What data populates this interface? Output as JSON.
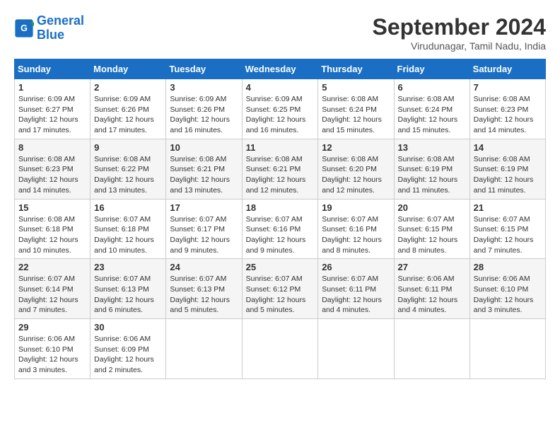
{
  "logo": {
    "line1": "General",
    "line2": "Blue"
  },
  "title": {
    "month_year": "September 2024",
    "location": "Virudunagar, Tamil Nadu, India"
  },
  "days_of_week": [
    "Sunday",
    "Monday",
    "Tuesday",
    "Wednesday",
    "Thursday",
    "Friday",
    "Saturday"
  ],
  "weeks": [
    [
      {
        "day": "1",
        "sunrise": "6:09 AM",
        "sunset": "6:27 PM",
        "daylight": "12 hours and 17 minutes."
      },
      {
        "day": "2",
        "sunrise": "6:09 AM",
        "sunset": "6:26 PM",
        "daylight": "12 hours and 17 minutes."
      },
      {
        "day": "3",
        "sunrise": "6:09 AM",
        "sunset": "6:26 PM",
        "daylight": "12 hours and 16 minutes."
      },
      {
        "day": "4",
        "sunrise": "6:09 AM",
        "sunset": "6:25 PM",
        "daylight": "12 hours and 16 minutes."
      },
      {
        "day": "5",
        "sunrise": "6:08 AM",
        "sunset": "6:24 PM",
        "daylight": "12 hours and 15 minutes."
      },
      {
        "day": "6",
        "sunrise": "6:08 AM",
        "sunset": "6:24 PM",
        "daylight": "12 hours and 15 minutes."
      },
      {
        "day": "7",
        "sunrise": "6:08 AM",
        "sunset": "6:23 PM",
        "daylight": "12 hours and 14 minutes."
      }
    ],
    [
      {
        "day": "8",
        "sunrise": "6:08 AM",
        "sunset": "6:23 PM",
        "daylight": "12 hours and 14 minutes."
      },
      {
        "day": "9",
        "sunrise": "6:08 AM",
        "sunset": "6:22 PM",
        "daylight": "12 hours and 13 minutes."
      },
      {
        "day": "10",
        "sunrise": "6:08 AM",
        "sunset": "6:21 PM",
        "daylight": "12 hours and 13 minutes."
      },
      {
        "day": "11",
        "sunrise": "6:08 AM",
        "sunset": "6:21 PM",
        "daylight": "12 hours and 12 minutes."
      },
      {
        "day": "12",
        "sunrise": "6:08 AM",
        "sunset": "6:20 PM",
        "daylight": "12 hours and 12 minutes."
      },
      {
        "day": "13",
        "sunrise": "6:08 AM",
        "sunset": "6:19 PM",
        "daylight": "12 hours and 11 minutes."
      },
      {
        "day": "14",
        "sunrise": "6:08 AM",
        "sunset": "6:19 PM",
        "daylight": "12 hours and 11 minutes."
      }
    ],
    [
      {
        "day": "15",
        "sunrise": "6:08 AM",
        "sunset": "6:18 PM",
        "daylight": "12 hours and 10 minutes."
      },
      {
        "day": "16",
        "sunrise": "6:07 AM",
        "sunset": "6:18 PM",
        "daylight": "12 hours and 10 minutes."
      },
      {
        "day": "17",
        "sunrise": "6:07 AM",
        "sunset": "6:17 PM",
        "daylight": "12 hours and 9 minutes."
      },
      {
        "day": "18",
        "sunrise": "6:07 AM",
        "sunset": "6:16 PM",
        "daylight": "12 hours and 9 minutes."
      },
      {
        "day": "19",
        "sunrise": "6:07 AM",
        "sunset": "6:16 PM",
        "daylight": "12 hours and 8 minutes."
      },
      {
        "day": "20",
        "sunrise": "6:07 AM",
        "sunset": "6:15 PM",
        "daylight": "12 hours and 8 minutes."
      },
      {
        "day": "21",
        "sunrise": "6:07 AM",
        "sunset": "6:15 PM",
        "daylight": "12 hours and 7 minutes."
      }
    ],
    [
      {
        "day": "22",
        "sunrise": "6:07 AM",
        "sunset": "6:14 PM",
        "daylight": "12 hours and 7 minutes."
      },
      {
        "day": "23",
        "sunrise": "6:07 AM",
        "sunset": "6:13 PM",
        "daylight": "12 hours and 6 minutes."
      },
      {
        "day": "24",
        "sunrise": "6:07 AM",
        "sunset": "6:13 PM",
        "daylight": "12 hours and 5 minutes."
      },
      {
        "day": "25",
        "sunrise": "6:07 AM",
        "sunset": "6:12 PM",
        "daylight": "12 hours and 5 minutes."
      },
      {
        "day": "26",
        "sunrise": "6:07 AM",
        "sunset": "6:11 PM",
        "daylight": "12 hours and 4 minutes."
      },
      {
        "day": "27",
        "sunrise": "6:06 AM",
        "sunset": "6:11 PM",
        "daylight": "12 hours and 4 minutes."
      },
      {
        "day": "28",
        "sunrise": "6:06 AM",
        "sunset": "6:10 PM",
        "daylight": "12 hours and 3 minutes."
      }
    ],
    [
      {
        "day": "29",
        "sunrise": "6:06 AM",
        "sunset": "6:10 PM",
        "daylight": "12 hours and 3 minutes."
      },
      {
        "day": "30",
        "sunrise": "6:06 AM",
        "sunset": "6:09 PM",
        "daylight": "12 hours and 2 minutes."
      },
      null,
      null,
      null,
      null,
      null
    ]
  ]
}
